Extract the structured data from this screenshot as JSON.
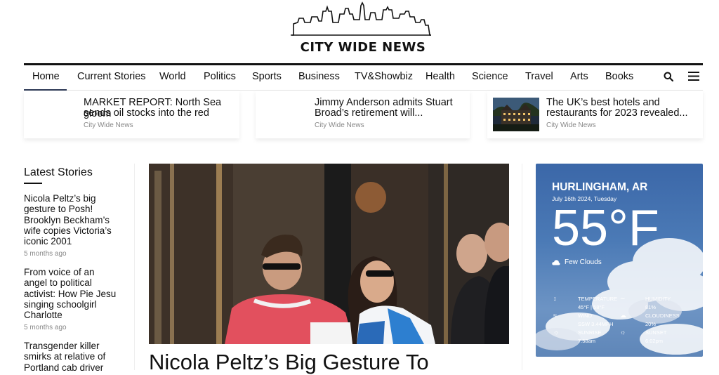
{
  "brand": {
    "name": "CITY WIDE NEWS"
  },
  "nav": {
    "items": [
      "Home",
      "Current Stories",
      "World",
      "Politics",
      "Sports",
      "Business",
      "TV&Showbiz",
      "Health",
      "Science",
      "Travel",
      "Arts",
      "Books"
    ],
    "active": "Home",
    "icons": [
      "search-icon",
      "menu-icon"
    ]
  },
  "top_stories": [
    {
      "title_line1": "MARKET REPORT: North Sea gloom",
      "title_line2": "sends oil stocks into the red",
      "source": "City Wide News"
    },
    {
      "title_line1": "Jimmy Anderson admits Stuart",
      "title_line2": "Broad’s retirement will...",
      "source": "City Wide News"
    },
    {
      "title_line1": "The UK’s best hotels and",
      "title_line2": "restaurants for 2023 revealed...",
      "source": "City Wide News"
    }
  ],
  "latest": {
    "heading": "Latest Stories",
    "items": [
      {
        "lines": [
          "Nicola Peltz’s big",
          "gesture to Posh!",
          "Brooklyn Beckham’s",
          "wife copies Victoria’s",
          "iconic 2001"
        ],
        "time": "5 months ago"
      },
      {
        "lines": [
          "From voice of an",
          "angel to political",
          "activist: How Pie Jesu",
          "singing schoolgirl",
          "Charlotte"
        ],
        "time": "5 months ago"
      },
      {
        "lines": [
          "Transgender killer",
          "smirks at relative of",
          "Portland cab driver"
        ]
      }
    ]
  },
  "hero": {
    "title": "Nicola Peltz’s Big Gesture To"
  },
  "weather": {
    "location": "HURLINGHAM, AR",
    "date": "July 16th 2024, Tuesday",
    "temperature": "55°F",
    "condition": "Few Clouds",
    "details": {
      "temperature_label": "TEMPERATURE",
      "temperature_value": "45°F | 58°F",
      "wind_label": "WIND",
      "wind_value": "SSW 3.44MPH",
      "sunrise_label": "SUNRISE",
      "sunrise_value": "7:58am",
      "humidity_label": "HUMIDITY",
      "humidity_value": "81%",
      "cloudiness_label": "CLOUDINESS",
      "cloudiness_value": "20%",
      "sunset_label": "SUNSET",
      "sunset_value": "6:02pm"
    }
  }
}
